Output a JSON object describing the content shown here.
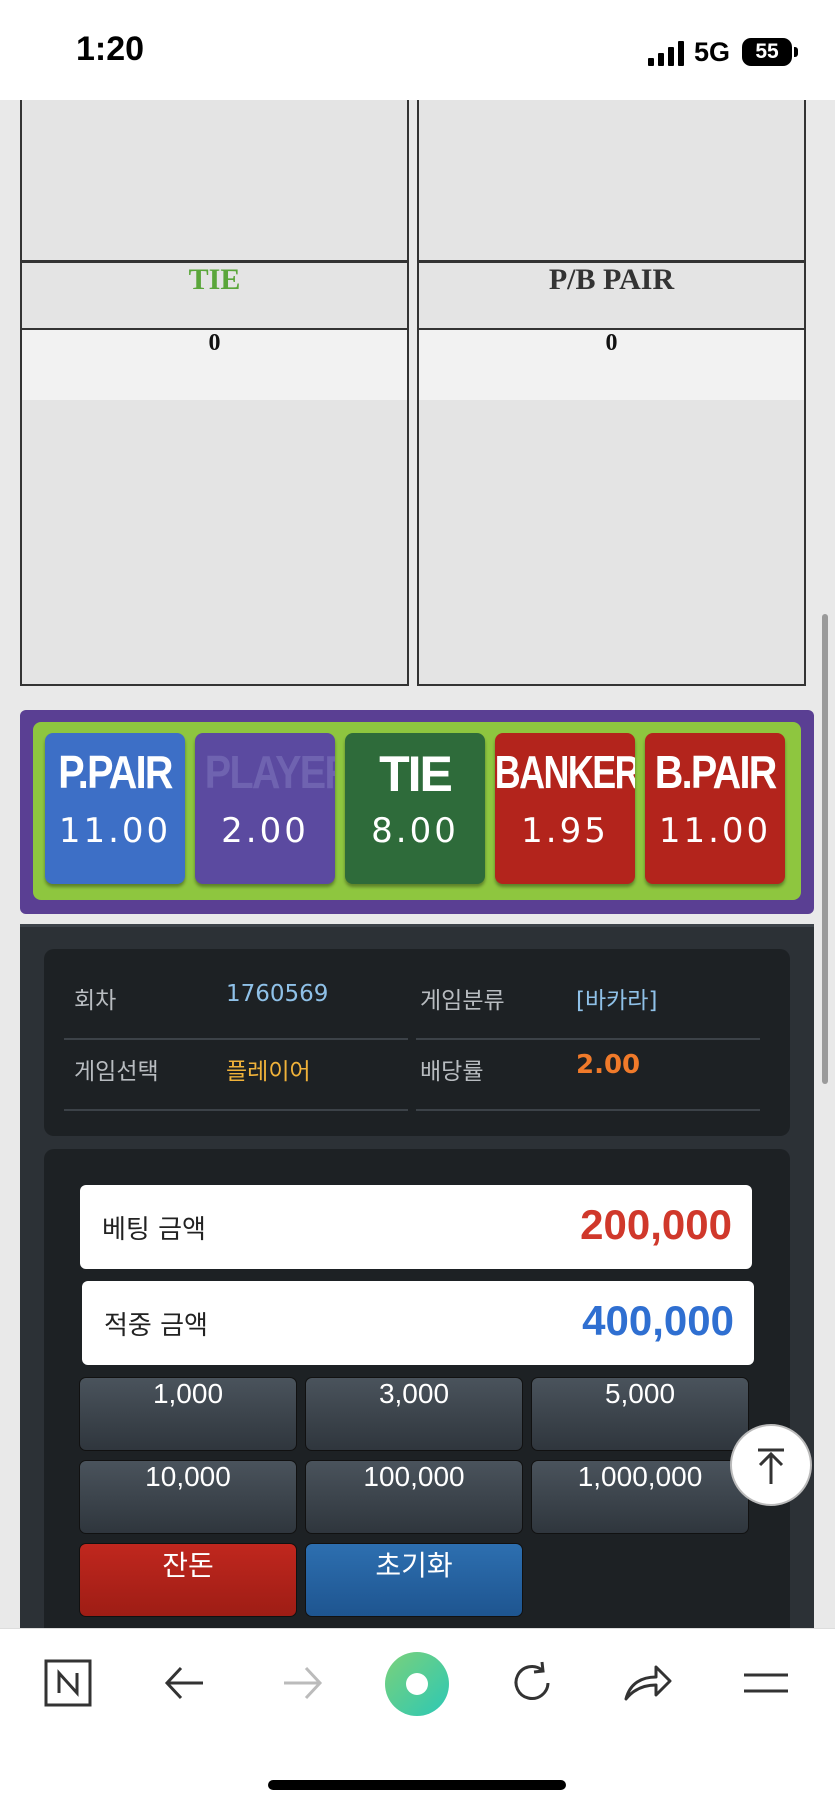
{
  "status_bar": {
    "time": "1:20",
    "network": "5G",
    "battery": "55"
  },
  "panels": [
    {
      "title": "TIE",
      "title_color": "#5aa63a",
      "value": "0"
    },
    {
      "title": "P/B PAIR",
      "title_color": "#333333",
      "value": "0"
    }
  ],
  "bet_buttons": [
    {
      "name": "P.PAIR",
      "odds": "11.00",
      "color": "#3d6fc6"
    },
    {
      "name": "PLAYER",
      "odds": "2.00",
      "color": "#5b4aa0",
      "selected": true
    },
    {
      "name": "TIE",
      "odds": "8.00",
      "color": "#2e6b3a"
    },
    {
      "name": "BANKER",
      "odds": "1.95",
      "color": "#b3241c"
    },
    {
      "name": "B.PAIR",
      "odds": "11.00",
      "color": "#b3241c"
    }
  ],
  "info": {
    "round_label": "회차",
    "round_value": "1760569",
    "category_label": "게임분류",
    "category_value": "[바카라]",
    "selection_label": "게임선택",
    "selection_value": "플레이어",
    "odds_label": "배당률",
    "odds_value": "2.00"
  },
  "amounts": {
    "bet_label": "베팅 금액",
    "bet_value": "200,000",
    "win_label": "적중 금액",
    "win_value": "400,000"
  },
  "chips": [
    "1,000",
    "3,000",
    "5,000",
    "10,000",
    "100,000",
    "1,000,000"
  ],
  "actions": {
    "balance_label": "잔돈",
    "reset_label": "초기화"
  }
}
